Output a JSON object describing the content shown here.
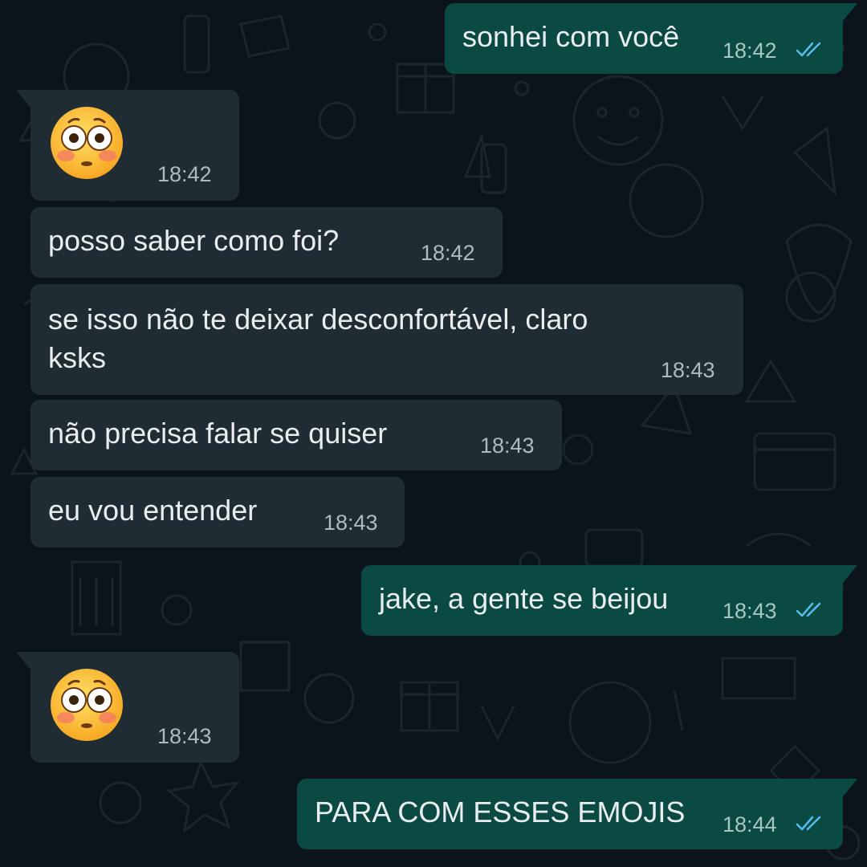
{
  "colors": {
    "background": "#0b141a",
    "incoming_bubble": "#202c33",
    "outgoing_bubble": "#0a4a42",
    "text": "#e9edef",
    "timestamp": "#aebac1",
    "read_ticks": "#53bdeb"
  },
  "messages": [
    {
      "direction": "outgoing",
      "text": "sonhei com você",
      "time": "18:42",
      "status": "read-ticks-icon"
    },
    {
      "direction": "incoming",
      "emoji": "flushed-face-emoji",
      "time": "18:42"
    },
    {
      "direction": "incoming",
      "text": "posso saber como foi?",
      "time": "18:42"
    },
    {
      "direction": "incoming",
      "text_line1": "se isso não te deixar desconfortável, claro",
      "text_line2": "ksks",
      "time": "18:43"
    },
    {
      "direction": "incoming",
      "text": "não precisa falar se quiser",
      "time": "18:43"
    },
    {
      "direction": "incoming",
      "text": "eu vou entender",
      "time": "18:43"
    },
    {
      "direction": "outgoing",
      "text": "jake, a gente se beijou",
      "time": "18:43",
      "status": "read-ticks-icon"
    },
    {
      "direction": "incoming",
      "emoji": "flushed-face-emoji",
      "time": "18:43"
    },
    {
      "direction": "outgoing",
      "text": "PARA COM ESSES EMOJIS",
      "time": "18:44",
      "status": "read-ticks-icon"
    }
  ]
}
